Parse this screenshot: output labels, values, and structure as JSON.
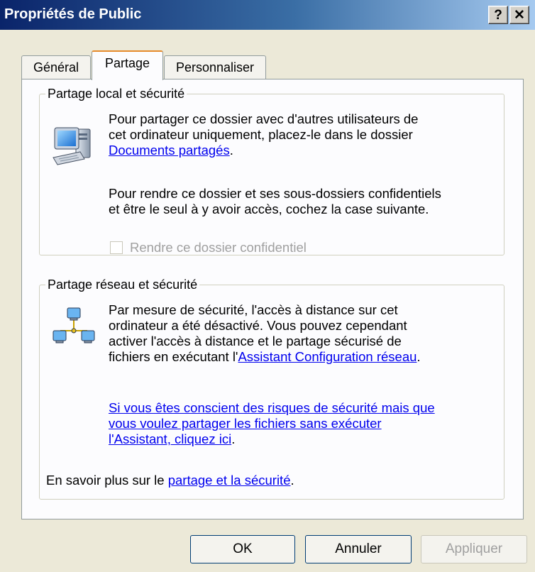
{
  "window": {
    "title": "Propriétés de Public",
    "help_label": "?",
    "close_label": "✕"
  },
  "tabs": [
    {
      "label": "Général"
    },
    {
      "label": "Partage",
      "selected": true
    },
    {
      "label": "Personnaliser"
    }
  ],
  "local_sharing": {
    "legend": "Partage local et sécurité",
    "icon": "computer-icon",
    "para1_line1": "Pour partager ce dossier avec d'autres utilisateurs de",
    "para1_line2": "cet ordinateur uniquement, placez-le dans le dossier",
    "para1_link": "Documents partagés",
    "para1_end": ".",
    "para2_line1": "Pour rendre ce dossier et ses sous-dossiers confidentiels",
    "para2_line2": "et être le seul à y avoir accès, cochez la case suivante.",
    "checkbox_label": "Rendre ce dossier confidentiel",
    "checkbox_checked": false,
    "checkbox_enabled": false
  },
  "network_sharing": {
    "legend": "Partage réseau et sécurité",
    "icon": "network-icon",
    "para1_line1": "Par mesure de sécurité, l'accès à distance sur cet",
    "para1_line2": "ordinateur a été désactivé. Vous pouvez cependant",
    "para1_line3": "activer l'accès à distance et le partage sécurisé de",
    "para1_line4_prefix": "fichiers en exécutant l'",
    "para1_link": "Assistant Configuration réseau",
    "para1_end": ".",
    "risk_link_line1": "Si vous êtes conscient des risques de sécurité mais que",
    "risk_link_line2": "vous voulez partager les fichiers sans exécuter",
    "risk_link_line3": "l'Assistant, cliquez ici",
    "risk_link_end": ".",
    "learn_prefix": "En savoir plus sur le ",
    "learn_link": "partage et la sécurité",
    "learn_end": "."
  },
  "buttons": {
    "ok": "OK",
    "cancel": "Annuler",
    "apply": "Appliquer"
  }
}
